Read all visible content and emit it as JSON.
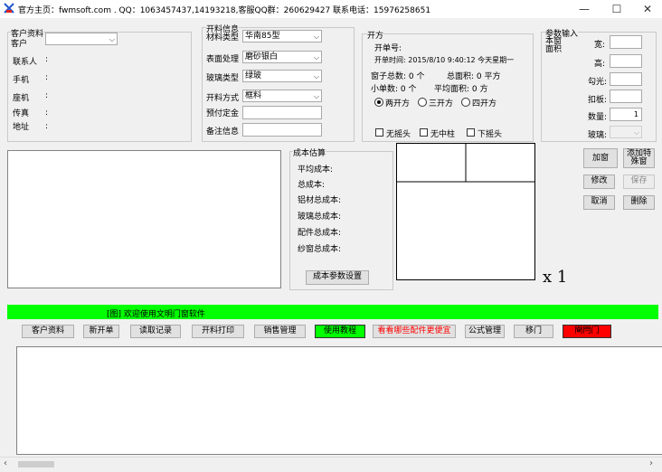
{
  "window": {
    "title": "官方主页：fwmsoft.com   . QQ：1063457437,14193218,客服QQ群：260629427   联系电话：15976258651",
    "min": "—",
    "max": "☐",
    "close": "✕"
  },
  "customer": {
    "group": "客户资料",
    "customer_label": "客户",
    "contact_label": "联系人",
    "mobile_label": "手机",
    "phone_label": "座机",
    "fax_label": "传真",
    "address_label": "地址",
    "colon": ":"
  },
  "material": {
    "group": "开料信息",
    "type_label": "材料类型",
    "type_value": "华南85型",
    "surface_label": "表面处理",
    "surface_value": "磨砂银白",
    "glass_label": "玻璃类型",
    "glass_value": "绿玻",
    "method_label": "开料方式",
    "method_value": "框料",
    "deposit_label": "预付定金",
    "note_label": "备注信息"
  },
  "open": {
    "group": "开方",
    "order_no": "开单号:",
    "time": "开单时间: 2015/8/10  9:40:12  今天星期一",
    "window_total": "窗子总数: 0 个",
    "total_area": "总面积: 0    平方",
    "small_count": "小单数: 0 个",
    "avg_area": "平均面积: 0 方",
    "r2": "两开方",
    "r3": "三开方",
    "r4": "四开方",
    "c1": "无摇头",
    "c2": "无中柱",
    "c3": "下摇头"
  },
  "params": {
    "group": "参数输入",
    "sub": "本窗面积",
    "width": "宽:",
    "height": "高:",
    "hook": "勾光:",
    "board": "扣板:",
    "qty": "数量:",
    "qty_value": "1",
    "glass": "玻璃:"
  },
  "cost": {
    "group": "成本估算",
    "avg": "平均成本:",
    "total": "总成本:",
    "al": "铝材总成本:",
    "glass": "玻璃总成本:",
    "parts": "配件总成本:",
    "screen": "纱窗总成本:",
    "settings": "成本参数设置"
  },
  "actions": {
    "add": "加窗",
    "add_special": "添加特殊窗",
    "modify": "修改",
    "save": "保存",
    "cancel": "取消",
    "delete": "删除"
  },
  "preview": {
    "scale": "x 1"
  },
  "status": {
    "text": "[图] 欢迎使用文明门窗软件"
  },
  "toolbar": {
    "customer": "客户资料",
    "new": "新开单",
    "read": "读取记录",
    "print": "开料打印",
    "sales": "销售管理",
    "tutorial": "使用教程",
    "cheap": "看看哪些配件更便宜",
    "formula": "公式管理",
    "door": "移门",
    "gate": "閘閂门"
  },
  "colors": {
    "status_green": "#00ff00",
    "tutorial_green": "#00ff00",
    "red_btn": "#ff0000"
  }
}
